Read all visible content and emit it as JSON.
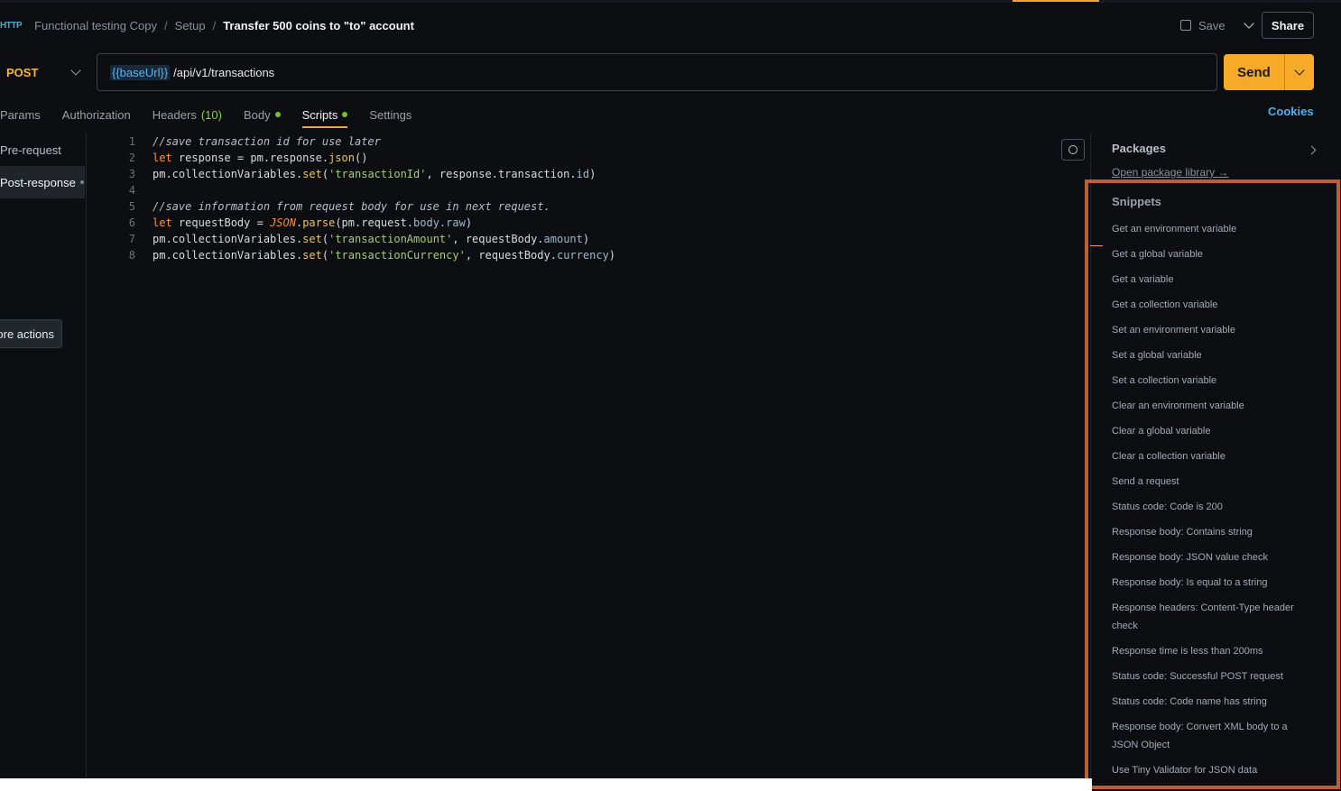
{
  "breadcrumb": {
    "icon_label": "HTTP",
    "collection": "Functional testing Copy",
    "folder": "Setup",
    "request": "Transfer 500 coins to \"to\" account"
  },
  "header": {
    "save_label": "Save",
    "share_label": "Share"
  },
  "request": {
    "method": "POST",
    "url_variable": "{{baseUrl}}",
    "url_path": "/api/v1/transactions",
    "send_label": "Send"
  },
  "tabs": [
    {
      "label": "Params"
    },
    {
      "label": "Authorization"
    },
    {
      "label": "Headers",
      "count": "(10)"
    },
    {
      "label": "Body"
    },
    {
      "label": "Scripts"
    },
    {
      "label": "Settings"
    }
  ],
  "cookies_label": "Cookies",
  "script_nav": {
    "pre": "Pre-request",
    "post": "Post-response",
    "more_actions": "ore actions"
  },
  "code": {
    "line_numbers": [
      "1",
      "2",
      "3",
      "4",
      "5",
      "6",
      "7",
      "8"
    ],
    "l1": "//save transaction id for use later",
    "l2_kw": "let",
    "l2_a": " response = pm.response.",
    "l2_fn": "json",
    "l2_b": "()",
    "l3_a": "pm.collectionVariables.",
    "l3_fn": "set",
    "l3_b": "(",
    "l3_str": "'transactionId'",
    "l3_c": ", response.transaction.",
    "l3_pr": "id",
    "l3_d": ")",
    "l5": "//save information from request body for use in next request.",
    "l6_kw": "let",
    "l6_a": " requestBody = ",
    "l6_cls": "JSON",
    "l6_b": ".",
    "l6_fn": "parse",
    "l6_c": "(pm.request.",
    "l6_pr": "body.raw",
    "l6_d": ")",
    "l7_a": "pm.collectionVariables.",
    "l7_fn": "set",
    "l7_b": "(",
    "l7_str": "'transactionAmount'",
    "l7_c": ", requestBody.",
    "l7_pr": "amount",
    "l7_d": ")",
    "l8_a": "pm.collectionVariables.",
    "l8_fn": "set",
    "l8_b": "(",
    "l8_str": "'transactionCurrency'",
    "l8_c": ", requestBody.",
    "l8_pr": "currency",
    "l8_d": ")"
  },
  "right_panel": {
    "packages_title": "Packages",
    "package_link": "Open package library →",
    "snippets_title": "Snippets",
    "snippets": [
      "Get an environment variable",
      "Get a global variable",
      "Get a variable",
      "Get a collection variable",
      "Set an environment variable",
      "Set a global variable",
      "Set a collection variable",
      "Clear an environment variable",
      "Clear a global variable",
      "Clear a collection variable",
      "Send a request",
      "Status code: Code is 200",
      "Response body: Contains string",
      "Response body: JSON value check",
      "Response body: Is equal to a string",
      "Response headers: Content-Type header check",
      "Response time is less than 200ms",
      "Status code: Successful POST request",
      "Status code: Code name has string",
      "Response body: Convert XML body to a JSON Object",
      "Use Tiny Validator for JSON data"
    ]
  },
  "colors": {
    "accent": "#f7a928",
    "link": "#4fb1f0",
    "highlight": "#e26b3c"
  }
}
